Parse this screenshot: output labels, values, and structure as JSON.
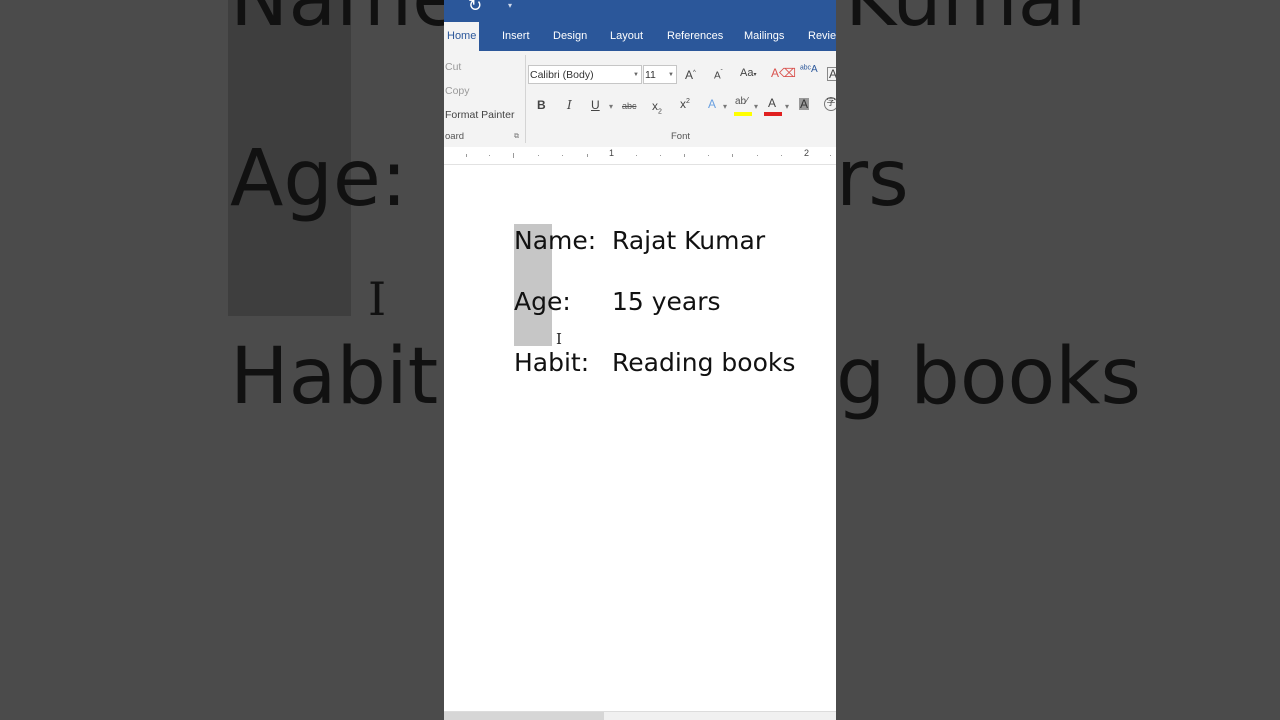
{
  "background_zoom": {
    "line1": "Name:",
    "line1_tail": "Kumar",
    "line2": "Age:",
    "line2_tail": "rs",
    "line3": "Habit",
    "line3_tail": "g books"
  },
  "ribbon": {
    "tabs": [
      "Home",
      "Insert",
      "Design",
      "Layout",
      "References",
      "Mailings",
      "Review"
    ],
    "active_tab": "Home",
    "clipboard": {
      "cut": "Cut",
      "copy": "Copy",
      "format_painter": "Format Painter",
      "label": "oard"
    },
    "font": {
      "family": "Calibri (Body)",
      "size": "11",
      "label": "Font"
    }
  },
  "ruler": {
    "marks": [
      "1",
      "2"
    ]
  },
  "document": {
    "rows": [
      {
        "label": "Name:",
        "value": "Rajat Kumar"
      },
      {
        "label": "Age:",
        "value": "15 years"
      },
      {
        "label": "Habit:",
        "value": "Reading books"
      }
    ]
  },
  "colors": {
    "accent": "#2b579a",
    "highlight_yellow": "#ffff00",
    "font_color_red": "#e02020",
    "selection": "#c6c6c6"
  }
}
